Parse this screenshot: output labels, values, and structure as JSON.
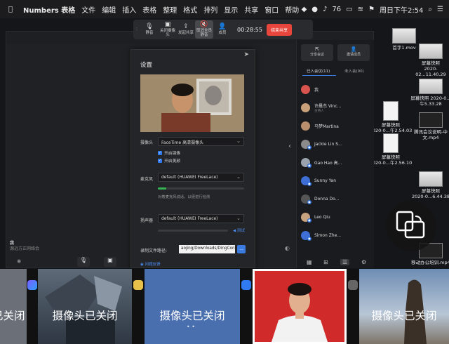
{
  "menubar": {
    "app_name": "Numbers 表格",
    "items": [
      "文件",
      "编辑",
      "插入",
      "表格",
      "整理",
      "格式",
      "排列",
      "显示",
      "共享",
      "窗口",
      "帮助"
    ],
    "battery": "76",
    "clock": "周日下午2:54"
  },
  "toolbar": {
    "items": [
      {
        "label": "静音",
        "icon": "mic-icon"
      },
      {
        "label": "关闭摄像头",
        "icon": "camera-icon"
      },
      {
        "label": "发起共享",
        "icon": "share-icon"
      },
      {
        "label": "取消全员静音",
        "icon": "mute-all-icon"
      },
      {
        "label": "成员",
        "icon": "member-icon"
      }
    ],
    "timer": "00:28:55",
    "end_label": "结束共享"
  },
  "self_view": {
    "name": "我",
    "status": "源远方正网络会"
  },
  "settings": {
    "title": "设置",
    "camera_label": "摄像头",
    "camera_value": "FaceTime 高清摄像头",
    "mirror_label": "开启镜像",
    "beauty_label": "开启美颜",
    "mic_label": "麦克风",
    "mic_value": "default (HUAWEI FreeLace)",
    "mic_level": 0.1,
    "mic_hint": "对着麦克风说话，以便进行检测",
    "speaker_label": "扬声器",
    "speaker_value": "default (HUAWEI FreeLace)",
    "speaker_test": "测试",
    "record_label": "录制文件路径:",
    "record_path": "aojing/Downloads/DingConference",
    "browse_label": "...",
    "feedback_label": "问题反馈"
  },
  "participants": {
    "invite_label": "分享会议",
    "manage_label": "邀请成员",
    "tab_joined": "已入会议(11)",
    "tab_pending": "未入会(90)",
    "rows": [
      {
        "name": "我",
        "sub": "",
        "color": "#d9534f"
      },
      {
        "name": "许晨杰 Vinc...",
        "sub": "主持人",
        "color": "#c8a17a"
      },
      {
        "name": "马梦Martina",
        "sub": "",
        "color": "#b98f6e"
      },
      {
        "name": "Jackie Lin S...",
        "sub": "",
        "color": "#8a8a8a"
      },
      {
        "name": "Gao Hao 高...",
        "sub": "",
        "color": "#9aa3ad"
      },
      {
        "name": "Sunny Yan",
        "sub": "",
        "color": "#3d6fd6"
      },
      {
        "name": "Donna Do...",
        "sub": "",
        "color": "#555"
      },
      {
        "name": "Leo Qiu",
        "sub": "",
        "color": "#c7a27f"
      },
      {
        "name": "Simon Zhe...",
        "sub": "",
        "color": "#3d6fd6"
      }
    ]
  },
  "desktop_files": [
    "首字1.mov",
    "屏幕快照\n2020-02...11.40.29",
    "屏幕快照 2020-0...午5.33.28",
    "屏幕快照\n2020-0...午2.54.03",
    "腾讯会议说明-中文.mp4",
    "屏幕快照\n2020-0...午2.56.10",
    "屏幕快照\n2020-0...6.44.38",
    "移动办公培训.mp4"
  ],
  "strip": {
    "camera_off_text": "摄像头已关闭"
  }
}
